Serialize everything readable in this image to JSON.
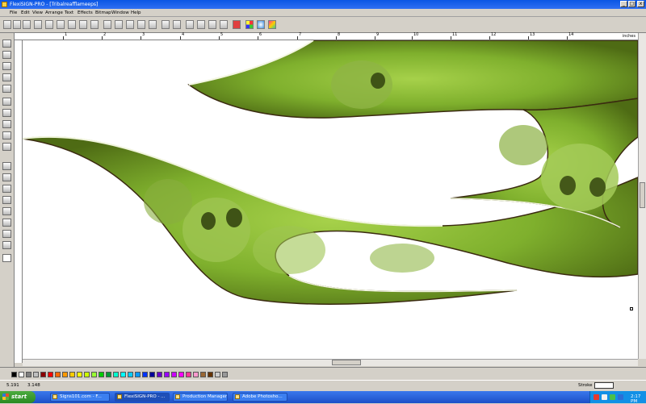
{
  "window": {
    "title": "FlexiSIGN-PRO - [Tribalreafflameeps]",
    "min": "_",
    "max": "□",
    "close": "x"
  },
  "menu": [
    "File",
    "Edit",
    "View",
    "Arrange",
    "Text",
    "Effects",
    "Bitmap",
    "Window",
    "Help"
  ],
  "ruler": {
    "labels": [
      "1",
      "2",
      "3",
      "4",
      "5",
      "6",
      "7",
      "8",
      "9",
      "10",
      "11",
      "12",
      "13",
      "14"
    ],
    "unit": "inches"
  },
  "status": {
    "x": "5.191",
    "y": "3.148",
    "stroke_label": "Stroke"
  },
  "palette_colors": [
    "#000000",
    "#ffffff",
    "#7f7f7f",
    "#bfbfbf",
    "#8b0000",
    "#ff0000",
    "#ff6600",
    "#ff9900",
    "#ffcc00",
    "#ffff00",
    "#ccff00",
    "#99ff33",
    "#00cc00",
    "#009933",
    "#00ffcc",
    "#00ffff",
    "#00ccff",
    "#0099ff",
    "#0033ff",
    "#000099",
    "#6600cc",
    "#9900ff",
    "#cc00ff",
    "#ff00ff",
    "#ff3399",
    "#ff99cc",
    "#996633",
    "#663300",
    "#cccccc",
    "#999999"
  ],
  "taskbar": {
    "start": "start",
    "tasks": [
      "Signs101.com - F...",
      "FlexiSIGN-PRO - ...",
      "Production Manager",
      "Adobe Photosho..."
    ],
    "clock": "2:17 PM"
  }
}
